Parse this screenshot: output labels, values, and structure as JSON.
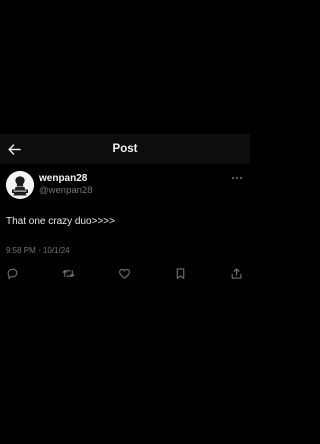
{
  "header": {
    "title": "Post",
    "back_icon": "arrow-left-icon"
  },
  "tweet": {
    "display_name": "wenpan28",
    "handle": "@wenpan28",
    "text": "That one crazy duo>>>>",
    "timestamp": "9:58 PM · 10/1/24",
    "avatar_icon": "avatar-image",
    "more_icon": "more-dots-icon"
  },
  "actions": [
    "reply-icon",
    "repost-icon",
    "like-icon",
    "bookmark-icon",
    "share-icon"
  ],
  "colors": {
    "background": "#000000",
    "header_background": "#0d0d0d",
    "primary_text": "#e7e9ea",
    "secondary_text": "#71767b"
  }
}
